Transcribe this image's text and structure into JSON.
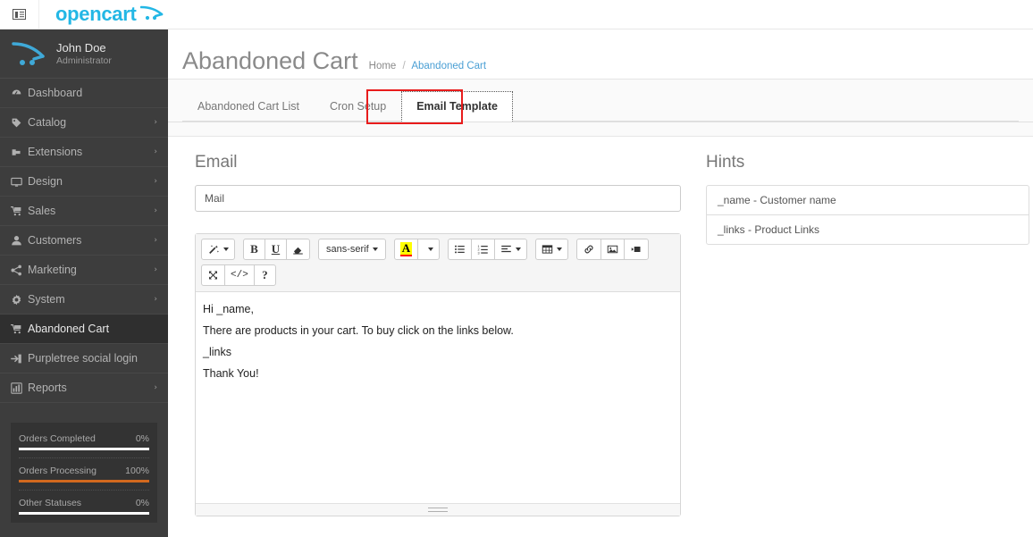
{
  "navbar": {
    "toggle_icon": "list-alt-icon",
    "brand_text": "opencart",
    "brand_mark_icon": "cart-swoosh-icon"
  },
  "sidebar": {
    "profile": {
      "avatar_icon": "cart-swoosh-avatar-icon",
      "name": "John Doe",
      "role": "Administrator"
    },
    "items": [
      {
        "label": "Dashboard",
        "icon": "dashboard-icon",
        "caret": "",
        "active": false
      },
      {
        "label": "Catalog",
        "icon": "tag-icon",
        "caret": "›",
        "active": false
      },
      {
        "label": "Extensions",
        "icon": "puzzle-icon",
        "caret": "›",
        "active": false
      },
      {
        "label": "Design",
        "icon": "desktop-icon",
        "caret": "›",
        "active": false
      },
      {
        "label": "Sales",
        "icon": "cart-icon",
        "caret": "›",
        "active": false
      },
      {
        "label": "Customers",
        "icon": "user-icon",
        "caret": "›",
        "active": false
      },
      {
        "label": "Marketing",
        "icon": "share-icon",
        "caret": "›",
        "active": false
      },
      {
        "label": "System",
        "icon": "gear-icon",
        "caret": "›",
        "active": false
      },
      {
        "label": "Abandoned Cart",
        "icon": "cart-icon",
        "caret": "",
        "active": true
      },
      {
        "label": "Purpletree social login",
        "icon": "sign-in-icon",
        "caret": "",
        "active": false
      },
      {
        "label": "Reports",
        "icon": "bar-chart-icon",
        "caret": "›",
        "active": false
      }
    ],
    "stats": [
      {
        "label": "Orders Completed",
        "value": "0%",
        "percent": 0,
        "color": "#ffffff"
      },
      {
        "label": "Orders Processing",
        "value": "100%",
        "percent": 100,
        "color": "#d2691e"
      },
      {
        "label": "Other Statuses",
        "value": "0%",
        "percent": 0,
        "color": "#ffffff"
      }
    ]
  },
  "page": {
    "title": "Abandoned Cart",
    "breadcrumb": {
      "home": "Home",
      "separator": "/",
      "current": "Abandoned Cart"
    }
  },
  "tabs": [
    {
      "label": "Abandoned Cart List",
      "active": false
    },
    {
      "label": "Cron Setup",
      "active": false
    },
    {
      "label": "Email Template",
      "active": true
    }
  ],
  "email_section": {
    "legend": "Email",
    "subject_value": "Mail",
    "subject_placeholder": "Mail"
  },
  "editor": {
    "toolbar_row1": [
      {
        "name": "style-magic-wand-button",
        "glyph": "magic",
        "caret": true
      },
      {
        "name": "bold-button",
        "glyph": "B",
        "caret": false
      },
      {
        "name": "underline-button",
        "glyph": "U",
        "caret": false
      },
      {
        "name": "remove-format-eraser-button",
        "glyph": "eraser",
        "caret": false
      },
      {
        "name": "font-name-button",
        "glyph": "sans-serif",
        "caret": true
      },
      {
        "name": "fore-color-button",
        "glyph": "A",
        "caret": false
      },
      {
        "name": "fore-color-dropdown-button",
        "glyph": "",
        "caret": true
      },
      {
        "name": "unordered-list-button",
        "glyph": "ul",
        "caret": false
      },
      {
        "name": "ordered-list-button",
        "glyph": "ol",
        "caret": false
      },
      {
        "name": "paragraph-align-button",
        "glyph": "align",
        "caret": true
      },
      {
        "name": "table-button",
        "glyph": "table",
        "caret": true
      },
      {
        "name": "link-button",
        "glyph": "link",
        "caret": false
      },
      {
        "name": "picture-button",
        "glyph": "picture",
        "caret": false
      },
      {
        "name": "video-button",
        "glyph": "video",
        "caret": false
      }
    ],
    "toolbar_row2": [
      {
        "name": "fullscreen-button",
        "glyph": "fullscreen",
        "caret": false
      },
      {
        "name": "code-view-button",
        "glyph": "</>",
        "caret": false
      },
      {
        "name": "help-button",
        "glyph": "?",
        "caret": false
      }
    ],
    "font_name": "sans-serif",
    "content_lines": [
      "Hi _name,",
      "There are products in your cart. To buy click on the links below.",
      "_links",
      "Thank You!"
    ],
    "resize_handle": "resize-grip"
  },
  "hints": {
    "legend": "Hints",
    "items": [
      "_name - Customer name",
      "_links - Product Links"
    ]
  },
  "colors": {
    "brand": "#23b7e5",
    "sidebar_bg": "#3d3d3d",
    "sidebar_active_bg": "#2f2f2f",
    "breadcrumb_link": "#4a9fd4",
    "highlight_box": "#e81c1c",
    "progress_orange": "#d2691e",
    "fore_color_highlight": "#ffff00"
  }
}
